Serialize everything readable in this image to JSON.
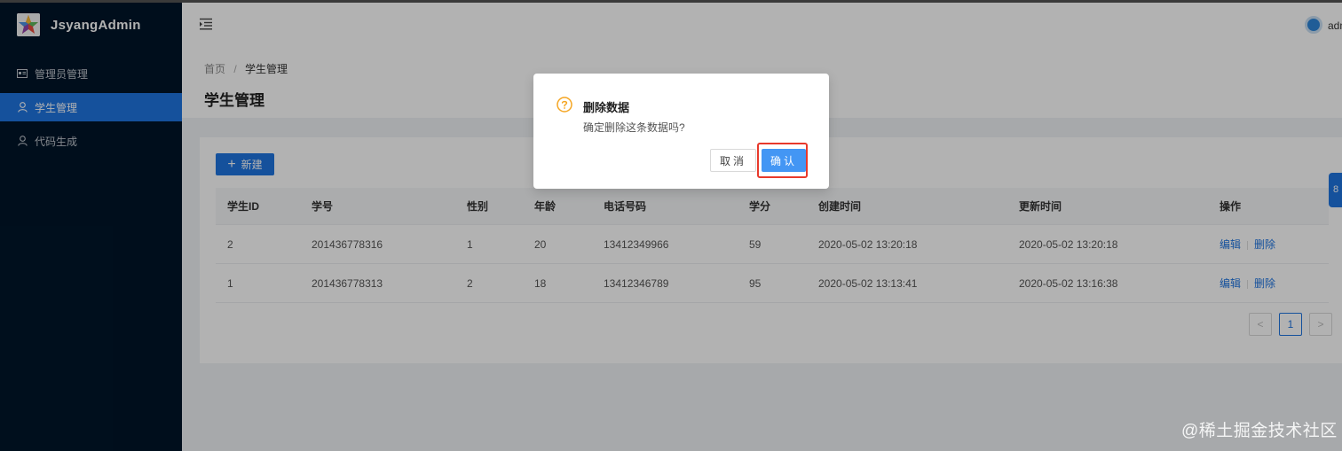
{
  "app": {
    "title": "JsyangAdmin"
  },
  "sidebar": {
    "items": [
      {
        "label": "管理员管理",
        "icon": "id-card-icon",
        "active": false
      },
      {
        "label": "学生管理",
        "icon": "user-icon",
        "active": true
      },
      {
        "label": "代码生成",
        "icon": "user-icon",
        "active": false
      }
    ]
  },
  "header": {
    "user_name": "adm"
  },
  "breadcrumb": {
    "home": "首页",
    "separator": "/",
    "current": "学生管理"
  },
  "page": {
    "title": "学生管理"
  },
  "toolbar": {
    "new_label": "新建"
  },
  "table": {
    "columns": [
      "学生ID",
      "学号",
      "性别",
      "年龄",
      "电话号码",
      "学分",
      "创建时间",
      "更新时间",
      "操作"
    ],
    "rows": [
      {
        "id": "2",
        "student_no": "201436778316",
        "gender": "1",
        "age": "20",
        "phone": "13412349966",
        "credits": "59",
        "created": "2020-05-02 13:20:18",
        "updated": "2020-05-02 13:20:18",
        "edit": "编辑",
        "delete": "删除"
      },
      {
        "id": "1",
        "student_no": "201436778313",
        "gender": "2",
        "age": "18",
        "phone": "13412346789",
        "credits": "95",
        "created": "2020-05-02 13:13:41",
        "updated": "2020-05-02 13:16:38",
        "edit": "编辑",
        "delete": "删除"
      }
    ]
  },
  "pagination": {
    "prev": "<",
    "current": "1",
    "next": ">"
  },
  "right_tab": {
    "label": "8"
  },
  "modal": {
    "title": "删除数据",
    "content": "确定删除这条数据吗?",
    "cancel_label": "取消",
    "ok_label": "确认"
  },
  "watermark": {
    "text": "@稀土掘金技术社区"
  },
  "colors": {
    "primary": "#1f74e0",
    "sidebar_bg": "#001529",
    "highlight": "#e8392b",
    "warning": "#f5a623"
  }
}
